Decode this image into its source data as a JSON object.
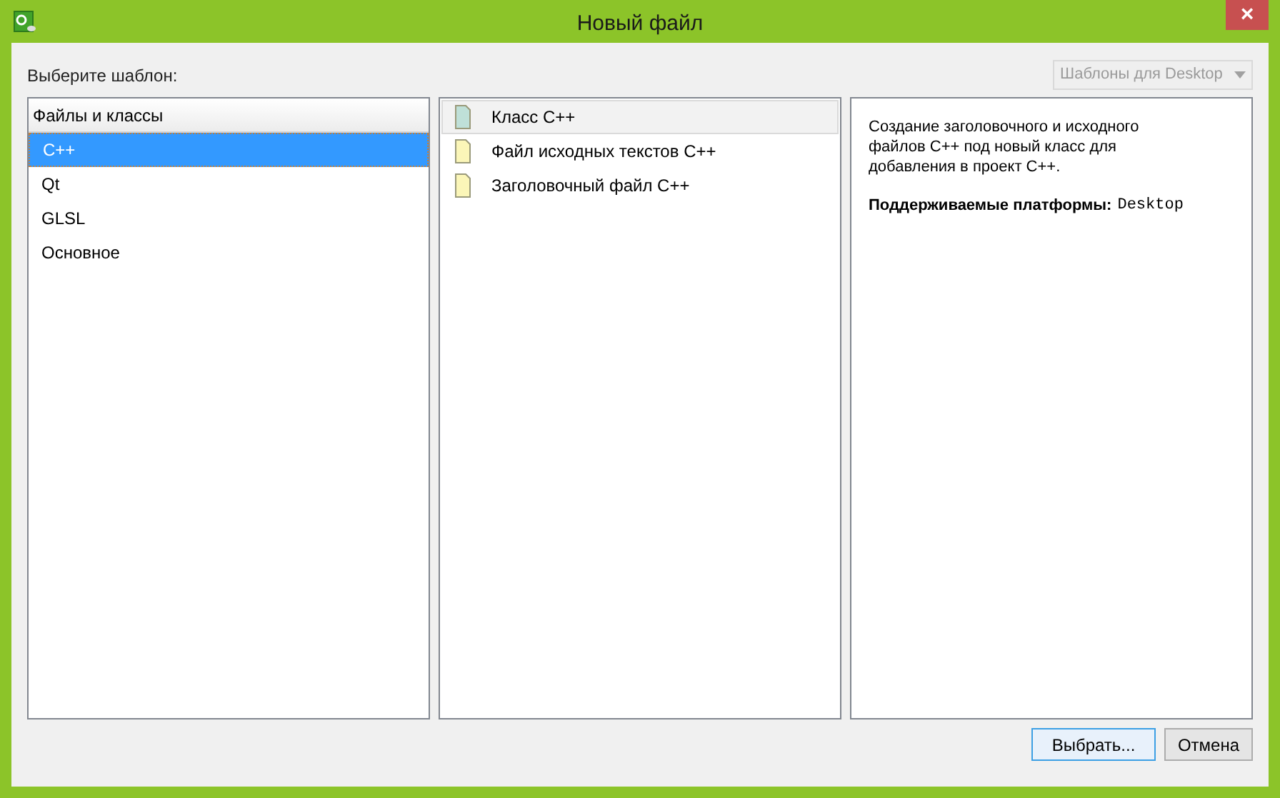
{
  "window": {
    "title": "Новый файл",
    "close": "×"
  },
  "prompt": "Выберите шаблон:",
  "platform_filter": {
    "value": "Шаблоны для Desktop",
    "disabled": true
  },
  "categories": {
    "header": "Файлы и классы",
    "items": [
      {
        "label": "C++",
        "selected": true
      },
      {
        "label": "Qt",
        "selected": false
      },
      {
        "label": "GLSL",
        "selected": false
      },
      {
        "label": "Основное",
        "selected": false
      }
    ]
  },
  "templates": [
    {
      "label": "Класс C++",
      "kind": "class",
      "selected": true
    },
    {
      "label": "Файл исходных текстов C++",
      "kind": "file",
      "selected": false
    },
    {
      "label": "Заголовочный файл C++",
      "kind": "file",
      "selected": false
    }
  ],
  "description": {
    "text": "Создание заголовочного и исходного файлов C++ под новый класс для добавления в проект C++.",
    "platforms_label": "Поддерживаемые платформы:",
    "platforms_value": "Desktop"
  },
  "buttons": [
    {
      "label": "Выбрать...",
      "default": true
    },
    {
      "label": "Отмена",
      "default": false
    }
  ]
}
